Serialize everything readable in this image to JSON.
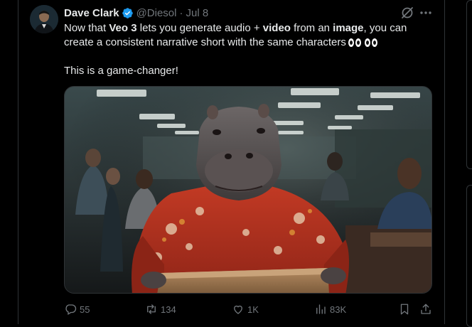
{
  "post": {
    "author_name": "Dave Clark",
    "handle": "@Diesol",
    "separator": "·",
    "date": "Jul 8",
    "text": {
      "line1_a": "Now that ",
      "line1_b": "Veo 3",
      "line1_c": " lets you generate audio + ",
      "line1_d": "video",
      "line1_e": " from an ",
      "line1_f": "image",
      "line1_g": ", you can",
      "line2": "create a consistent narrative short with the same characters",
      "para2": "This is a game-changer!"
    },
    "media": {
      "kind": "video-still",
      "subject": "hippo-in-hawaiian-shirt-office"
    }
  },
  "icons": {
    "verified": "verified-badge-icon",
    "grok": "grok-icon",
    "more": "more-dots-icon"
  },
  "actions": {
    "replies": "55",
    "reposts": "134",
    "likes": "1K",
    "views": "83K"
  },
  "colors": {
    "background": "#000000",
    "text": "#e7e9ea",
    "muted": "#71767b",
    "verified": "#1d9bf0",
    "border": "#2f3336"
  }
}
